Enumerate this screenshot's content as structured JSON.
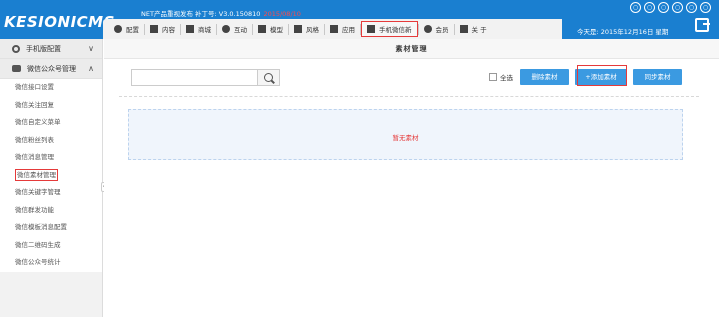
{
  "header": {
    "logo_main": "KESION",
    "logo_accent": "ICMS",
    "version_text": "NET产品重视发布 补丁号: V3.0.150810",
    "version_date": "2015/08/10",
    "today": "今天是: 2015年12月16日 星期",
    "top_icons": [
      "circle-icon-1",
      "circle-icon-2",
      "circle-icon-3",
      "circle-icon-4",
      "circle-icon-5",
      "circle-icon-6"
    ]
  },
  "nav": {
    "items": [
      {
        "label": "配置",
        "icon": "gear-icon"
      },
      {
        "label": "内容",
        "icon": "document-icon"
      },
      {
        "label": "商城",
        "icon": "shop-icon"
      },
      {
        "label": "互动",
        "icon": "users-icon"
      },
      {
        "label": "模型",
        "icon": "grid-icon"
      },
      {
        "label": "风格",
        "icon": "tag-icon"
      },
      {
        "label": "应用",
        "icon": "monitor-icon"
      },
      {
        "label": "手机微信新",
        "icon": "menu-icon",
        "active": true
      },
      {
        "label": "会员",
        "icon": "user-icon"
      },
      {
        "label": "关 于",
        "icon": "menu-icon"
      }
    ]
  },
  "sidebar": {
    "section1": "手机版配置",
    "section2": "微信公众号管理",
    "items": [
      "微信接口设置",
      "微信关注回复",
      "微信自定义菜单",
      "微信粉丝列表",
      "微信消息管理",
      "微信素材管理",
      "微信关键字管理",
      "微信群发功能",
      "微信模板消息配置",
      "微信二维码生成",
      "微信公众号统计"
    ],
    "active_index": 5
  },
  "main": {
    "title": "素材管理",
    "search_placeholder": "",
    "select_all": "全选",
    "delete_btn": "删除素材",
    "add_btn": "+添加素材",
    "sync_btn": "同步素材",
    "empty_text": "暂无素材"
  },
  "colors": {
    "header_bg": "#1a7fd0",
    "button_bg": "#3b9ae1",
    "highlight": "#e53a3a"
  }
}
